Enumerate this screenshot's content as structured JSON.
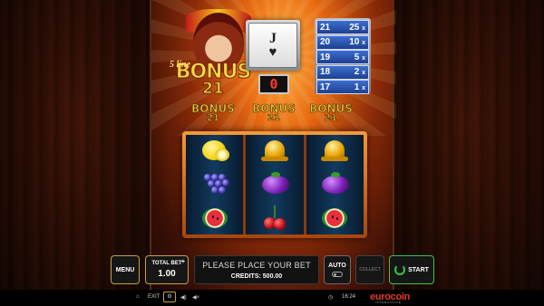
{
  "game": {
    "logo": {
      "prefix": "5 line",
      "word": "BONUS",
      "number": "21"
    },
    "card": {
      "rank": "J",
      "suit": "♥"
    },
    "counter": "0",
    "paytable": [
      {
        "points": "21",
        "mult": "25",
        "x": "x"
      },
      {
        "points": "20",
        "mult": "10",
        "x": "x"
      },
      {
        "points": "19",
        "mult": "5",
        "x": "x"
      },
      {
        "points": "18",
        "mult": "2",
        "x": "x"
      },
      {
        "points": "17",
        "mult": "1",
        "x": "x"
      }
    ],
    "mini_logos": [
      {
        "word": "BONUS",
        "number": "21"
      },
      {
        "word": "BONUS",
        "number": "21"
      },
      {
        "word": "BONUS",
        "number": "21"
      }
    ],
    "reels": [
      [
        "lemon",
        "grapes",
        "watermelon"
      ],
      [
        "bell",
        "plum",
        "cherries"
      ],
      [
        "bell",
        "plum",
        "watermelon"
      ]
    ]
  },
  "controls": {
    "menu": "MENU",
    "total_bet_label": "TOTAL BET",
    "total_bet_plus": "+",
    "total_bet_value": "1.00",
    "message": "PLEASE PLACE YOUR BET",
    "credits": "CREDITS: 500.00",
    "auto": "AUTO",
    "collect": "COLLECT",
    "start": "START"
  },
  "footer": {
    "exit": "EXIT",
    "time": "16:24",
    "brand": "eurocoin",
    "brand_sub": "INTERACTIVE"
  },
  "colors": {
    "accent": "#c6a23a",
    "start": "#3ec24a",
    "counter": "#ff3b2e",
    "brand": "#e23a2a"
  }
}
